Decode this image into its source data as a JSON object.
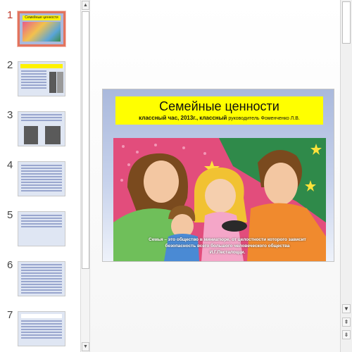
{
  "thumbnails": [
    {
      "number": "1",
      "selected": true,
      "heading": "Семейные ценности"
    },
    {
      "number": "2",
      "selected": false
    },
    {
      "number": "3",
      "selected": false
    },
    {
      "number": "4",
      "selected": false
    },
    {
      "number": "5",
      "selected": false
    },
    {
      "number": "6",
      "selected": false
    },
    {
      "number": "7",
      "selected": false
    }
  ],
  "slide": {
    "title": "Семейные ценности",
    "subtitle_part1": "классный час, 2013г.,",
    "subtitle_part2": "классный",
    "subtitle_part3": "руководитель  Фоменченко Л.В.",
    "caption_line": "Семья – это общество в миниатюре, от целостности которого зависит безопасность всего большого  человеческого общества",
    "caption_author": "И.Г.Песталоцци."
  },
  "scroll_icons": {
    "up": "up-arrow",
    "down": "down-arrow",
    "prev_slide": "double-up-arrow",
    "next_slide": "double-down-arrow"
  },
  "colors": {
    "selection": "#e3735d",
    "title_bg": "#ffff00",
    "slide_bg": "#aab9dc"
  }
}
